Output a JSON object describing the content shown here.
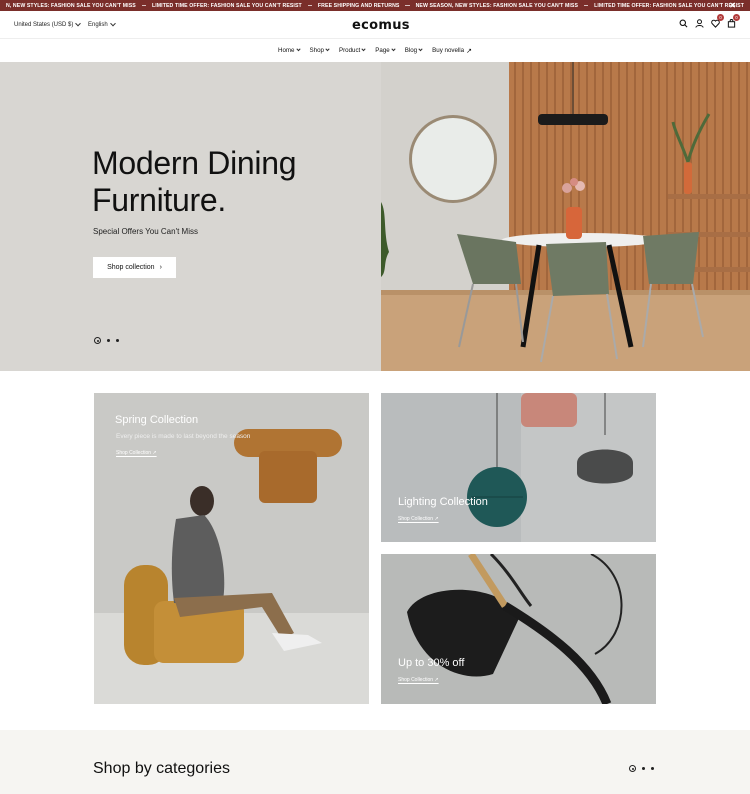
{
  "announcement": {
    "messages": [
      "N, NEW STYLES: FASHION SALE YOU CAN'T MISS",
      "LIMITED TIME OFFER: FASHION SALE YOU CAN'T RESIST",
      "FREE SHIPPING AND RETURNS",
      "NEW SEASON, NEW STYLES: FASHION SALE YOU CAN'T MISS",
      "LIMITED TIME OFFER: FASHION SALE YOU CAN'T RESIST"
    ],
    "close_icon": "close-icon",
    "color": "#7a2e2a"
  },
  "header": {
    "currency": "United States (USD $)",
    "language": "English",
    "logo": "ecomus",
    "wishlist_count": "0",
    "cart_count": "0"
  },
  "nav": {
    "items": [
      {
        "label": "Home"
      },
      {
        "label": "Shop"
      },
      {
        "label": "Product"
      },
      {
        "label": "Page"
      },
      {
        "label": "Blog"
      },
      {
        "label": "Buy novella"
      }
    ]
  },
  "hero": {
    "title_line1": "Modern Dining",
    "title_line2": "Furniture.",
    "subtitle": "Special Offers You Can't Miss",
    "cta": "Shop collection",
    "cta_arrow": "›",
    "slides": 3,
    "active_slide": 1
  },
  "collections": [
    {
      "title": "Spring Collection",
      "desc": "Every piece is made to last beyond the season",
      "link": "Shop Collection ↗"
    },
    {
      "title": "Lighting Collection",
      "link": "Shop Collection ↗"
    },
    {
      "title": "Up to 30% off",
      "link": "Shop Collection ↗"
    }
  ],
  "categories": {
    "title": "Shop by categories",
    "slides": 3,
    "active_slide": 1
  }
}
